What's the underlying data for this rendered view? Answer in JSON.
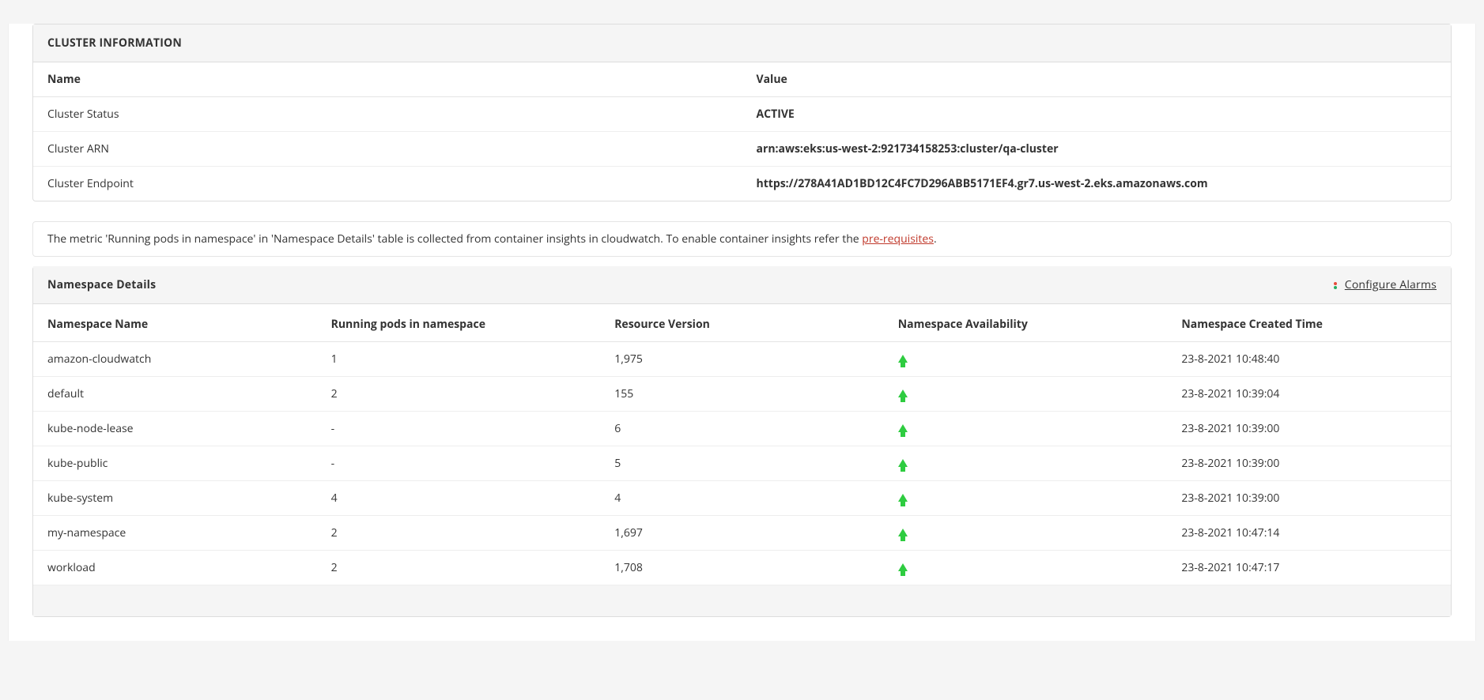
{
  "cluster_info": {
    "title": "CLUSTER INFORMATION",
    "headers": {
      "name": "Name",
      "value": "Value"
    },
    "rows": [
      {
        "name": "Cluster Status",
        "value": "ACTIVE"
      },
      {
        "name": "Cluster ARN",
        "value": "arn:aws:eks:us-west-2:921734158253:cluster/qa-cluster"
      },
      {
        "name": "Cluster Endpoint",
        "value": "https://278A41AD1BD12C4FC7D296ABB5171EF4.gr7.us-west-2.eks.amazonaws.com"
      }
    ]
  },
  "note": {
    "text_before": "The metric 'Running pods in namespace' in 'Namespace Details' table is collected from container insights in cloudwatch. To enable container insights refer the ",
    "link_text": "pre-requisites",
    "text_after": "."
  },
  "namespace_details": {
    "title": "Namespace Details",
    "configure_label": "Configure Alarms",
    "columns": {
      "name": "Namespace Name",
      "pods": "Running pods in namespace",
      "version": "Resource Version",
      "availability": "Namespace Availability",
      "created": "Namespace Created Time"
    },
    "rows": [
      {
        "name": "amazon-cloudwatch",
        "pods": "1",
        "version": "1,975",
        "availability": "up",
        "created": "23-8-2021 10:48:40"
      },
      {
        "name": "default",
        "pods": "2",
        "version": "155",
        "availability": "up",
        "created": "23-8-2021 10:39:04"
      },
      {
        "name": "kube-node-lease",
        "pods": "-",
        "version": "6",
        "availability": "up",
        "created": "23-8-2021 10:39:00"
      },
      {
        "name": "kube-public",
        "pods": "-",
        "version": "5",
        "availability": "up",
        "created": "23-8-2021 10:39:00"
      },
      {
        "name": "kube-system",
        "pods": "4",
        "version": "4",
        "availability": "up",
        "created": "23-8-2021 10:39:00"
      },
      {
        "name": "my-namespace",
        "pods": "2",
        "version": "1,697",
        "availability": "up",
        "created": "23-8-2021 10:47:14"
      },
      {
        "name": "workload",
        "pods": "2",
        "version": "1,708",
        "availability": "up",
        "created": "23-8-2021 10:47:17"
      }
    ]
  }
}
